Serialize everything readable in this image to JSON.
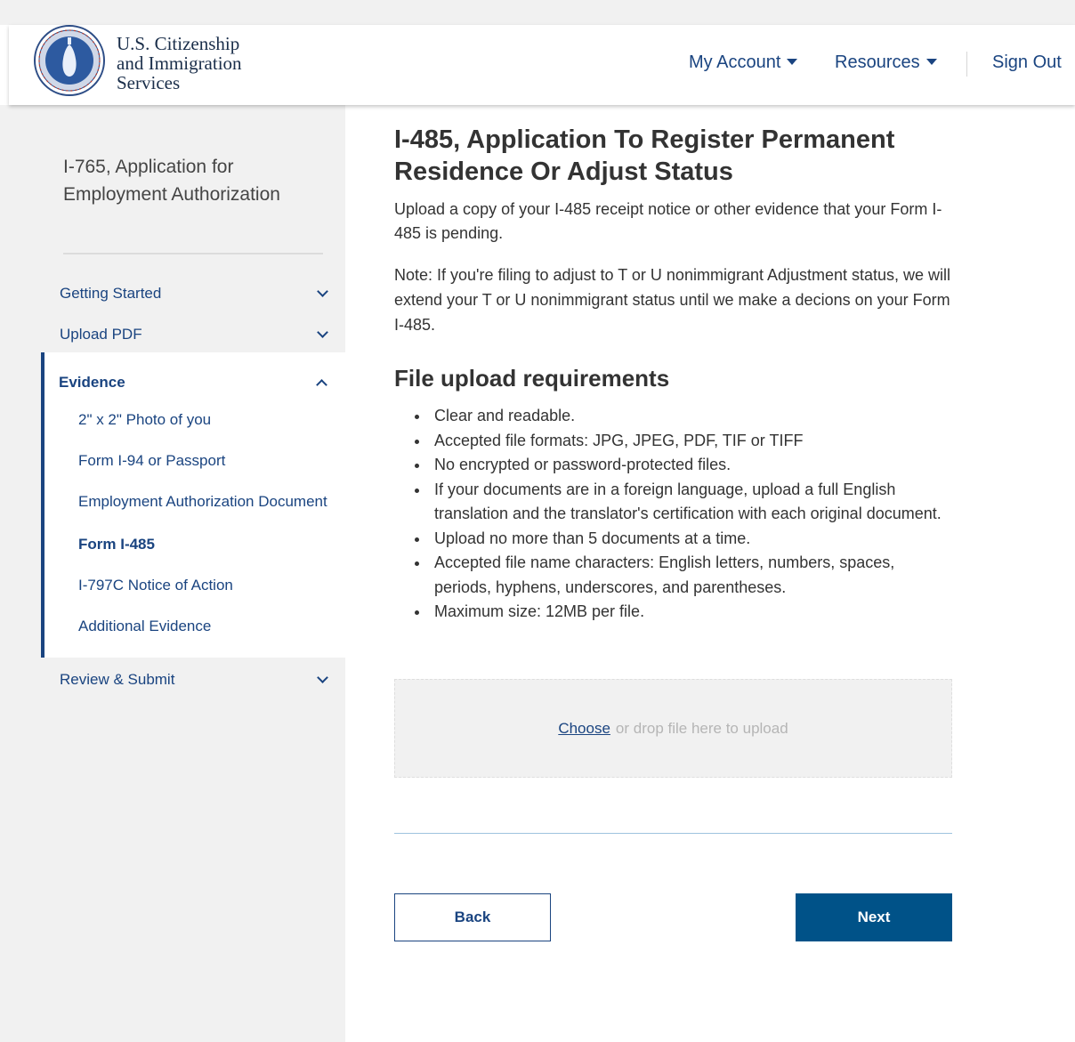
{
  "header": {
    "logo_lines": [
      "U.S. Citizenship",
      "and Immigration",
      "Services"
    ],
    "nav": {
      "my_account": "My Account",
      "resources": "Resources",
      "sign_out": "Sign Out"
    }
  },
  "sidebar": {
    "title": "I-765, Application for Employment Authorization",
    "sections": {
      "getting_started": "Getting Started",
      "upload_pdf": "Upload PDF",
      "evidence": "Evidence",
      "review_submit": "Review & Submit"
    },
    "evidence_items": [
      "2\" x 2\" Photo of you",
      "Form I-94 or Passport",
      "Employment Authorization Document",
      "Form I-485",
      "I-797C Notice of Action",
      "Additional Evidence"
    ],
    "current_item": "Form I-485"
  },
  "main": {
    "title": "I-485, Application To Register Permanent Residence Or Adjust Status",
    "intro": "Upload a copy of your I-485 receipt notice or other evidence that your Form I-485 is pending.",
    "note": "Note: If you're filing to adjust to T or U nonimmigrant Adjustment status, we will extend your T or U nonimmigrant status until we make a decions on your Form I-485.",
    "requirements_title": "File upload requirements",
    "requirements": [
      "Clear and readable.",
      "Accepted file formats: JPG, JPEG, PDF, TIF or TIFF",
      "No encrypted or password-protected files.",
      "If your documents are in a foreign language, upload a full English translation and the translator's certification with each original document.",
      "Upload no more than 5 documents at a time.",
      "Accepted file name characters: English letters, numbers, spaces, periods, hyphens, underscores, and parentheses.",
      "Maximum size: 12MB per file."
    ],
    "upload": {
      "choose_label": "Choose",
      "drop_text": "or drop file here to upload"
    },
    "buttons": {
      "back": "Back",
      "next": "Next"
    }
  },
  "colors": {
    "primary": "#005288",
    "link": "#1a4480",
    "sidebar_bg": "#f1f1f1"
  },
  "icons": {
    "logo": "uscis-seal-icon",
    "dropdown": "caret-down-icon",
    "expand": "chevron-down-icon",
    "collapse": "chevron-up-icon"
  }
}
